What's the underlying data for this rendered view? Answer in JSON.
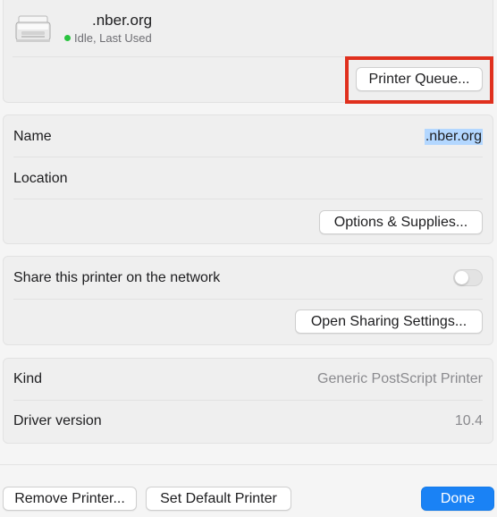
{
  "printer": {
    "name": ".nber.org",
    "status": "Idle, Last Used",
    "status_color": "#29c33f",
    "icon": "printer-icon",
    "queue_button": "Printer Queue..."
  },
  "details": {
    "name_label": "Name",
    "name_value": ".nber.org",
    "location_label": "Location",
    "options_button": "Options & Supplies..."
  },
  "sharing": {
    "share_label": "Share this printer on the network",
    "share_enabled": false,
    "open_sharing_button": "Open Sharing Settings..."
  },
  "info": {
    "kind_label": "Kind",
    "kind_value": "Generic PostScript Printer",
    "driver_label": "Driver version",
    "driver_value": "10.4"
  },
  "footer": {
    "remove_button": "Remove Printer...",
    "default_button": "Set Default Printer",
    "done_button": "Done"
  },
  "colors": {
    "accent": "#1a82f5",
    "highlight": "#e0301e",
    "selection": "#b3d7ff"
  }
}
